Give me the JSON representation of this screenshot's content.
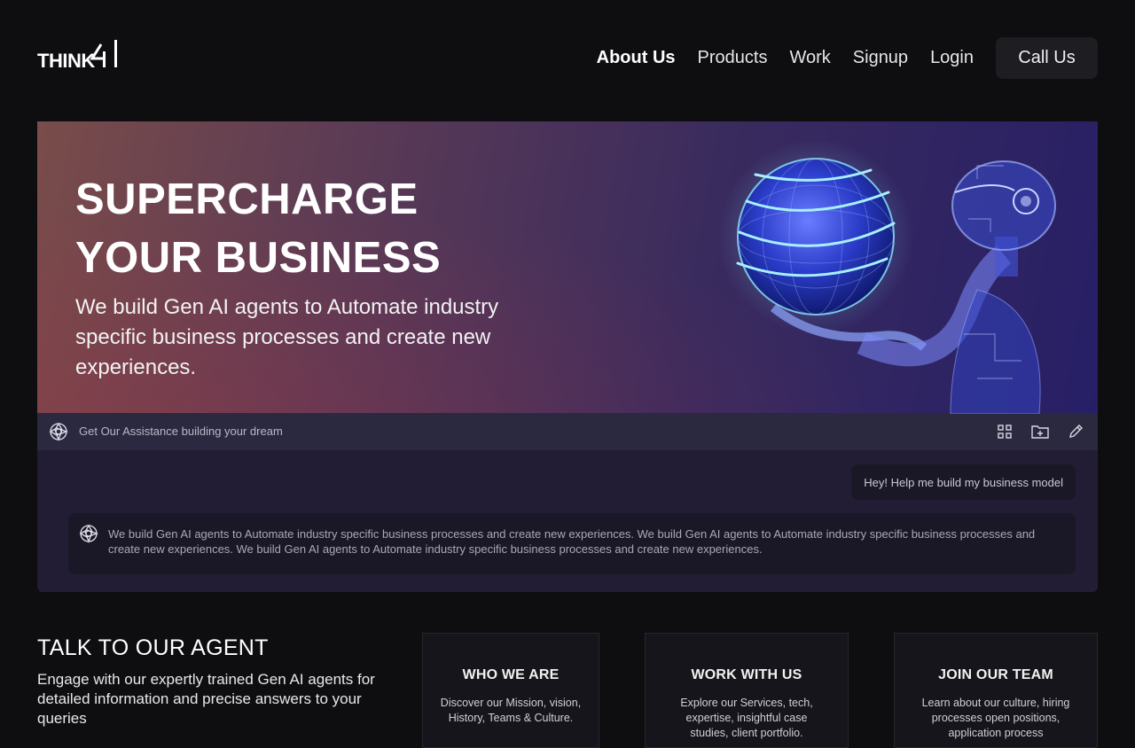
{
  "logo": {
    "text": "THINK",
    "icon": "brand-mark-icon"
  },
  "nav": {
    "items": [
      {
        "label": "About Us",
        "active": true
      },
      {
        "label": "Products"
      },
      {
        "label": "Work"
      },
      {
        "label": "Signup"
      },
      {
        "label": "Login"
      }
    ],
    "cta": "Call Us"
  },
  "hero": {
    "title_line1": "SUPERCHARGE",
    "title_line2": "YOUR BUSINESS",
    "subtitle": "We build Gen AI agents to Automate industry specific business processes and create new experiences.",
    "art": "ai-robot-globe-illustration"
  },
  "chat": {
    "bar_text": "Get Our Assistance building your dream",
    "icons": [
      "grid-icon",
      "folder-add-icon",
      "edit-pencil-icon"
    ],
    "user_message": "Hey! Help me build my business model",
    "bot_message": "We build Gen AI agents to Automate industry specific business processes and create new experiences. We build Gen AI agents to Automate industry specific business processes and create new experiences. We build Gen AI agents to Automate industry specific business processes and create new experiences."
  },
  "agent": {
    "title": "TALK TO OUR AGENT",
    "description": "Engage with our expertly trained Gen AI agents for detailed information and precise answers to your queries"
  },
  "cards": [
    {
      "title": "WHO WE ARE",
      "text": "Discover our Mission, vision, History, Teams & Culture."
    },
    {
      "title": "WORK WITH US",
      "text": "Explore our Services, tech, expertise, insightful case studies, client portfolio."
    },
    {
      "title": "JOIN OUR TEAM",
      "text": "Learn about our culture, hiring processes open positions, application process"
    }
  ],
  "colors": {
    "background": "#0e0e10",
    "chat_panel": "#221d35",
    "chat_bar": "#2a2940",
    "card_bg": "#15151b"
  }
}
